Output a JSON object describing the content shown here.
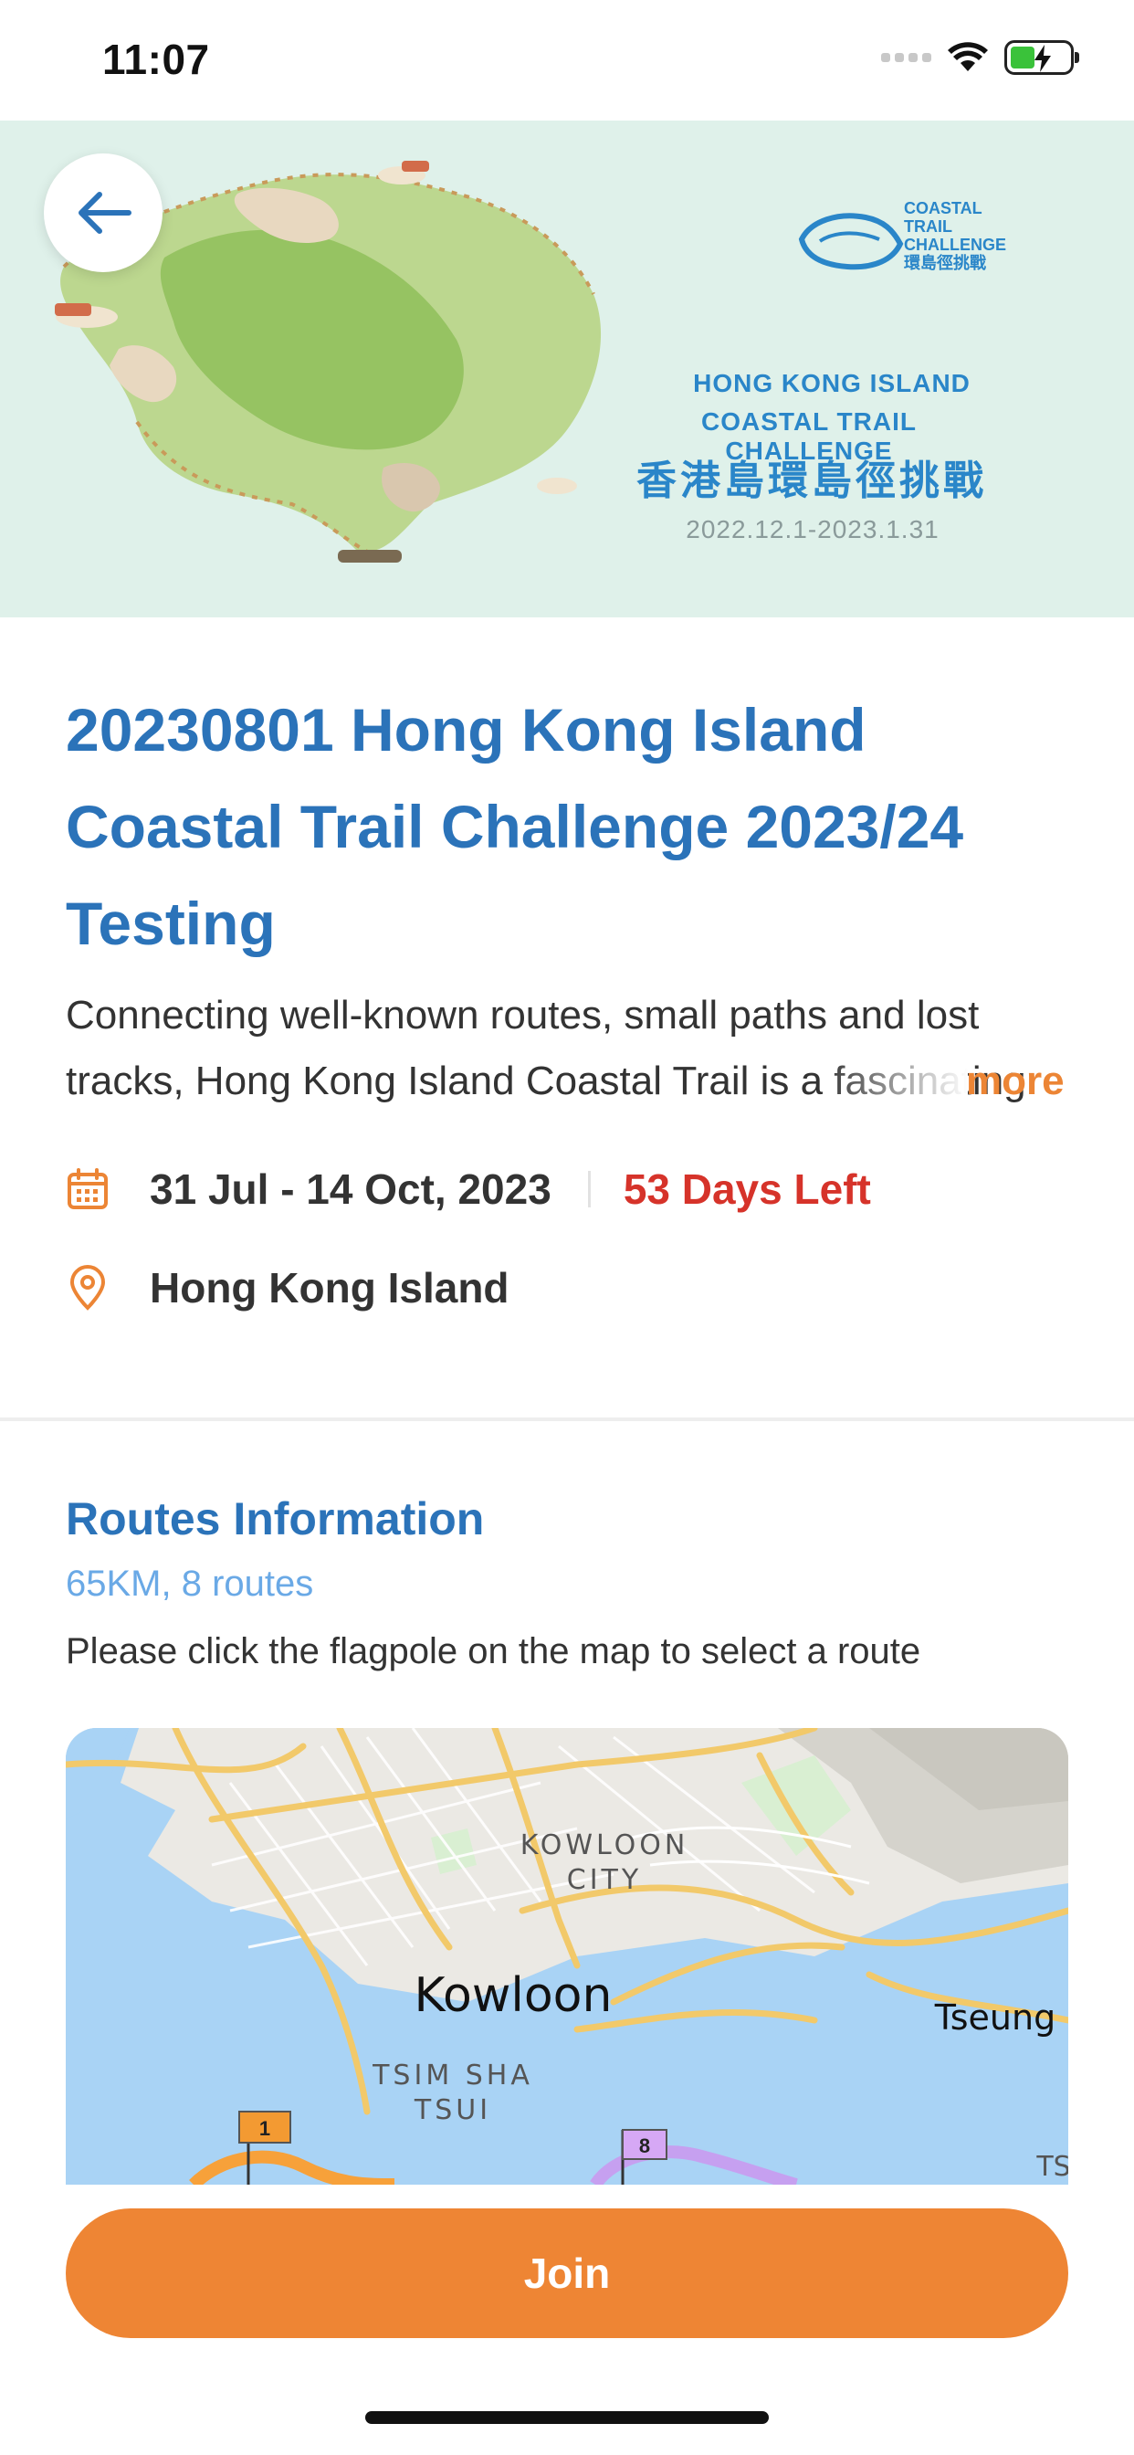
{
  "status_bar": {
    "time": "11:07",
    "icons": [
      "signal-dots-icon",
      "wifi-icon",
      "battery-charging-icon"
    ]
  },
  "banner": {
    "logo_text_line1": "COASTAL",
    "logo_text_line2": "TRAIL",
    "logo_text_line3": "CHALLENGE",
    "logo_text_line4": "環島徑挑戰",
    "title_en_line1": "HONG KONG ISLAND",
    "title_en_line2": "COASTAL TRAIL CHALLENGE",
    "title_zh": "香港島環島徑挑戰",
    "dates": "2022.12.1-2023.1.31"
  },
  "event": {
    "title": "20230801 Hong Kong Island Coastal Trail Challenge 2023/24 Testing",
    "description": "Connecting well-known routes, small paths and lost tracks, Hong Kong Island Coastal Trail is a fascinating",
    "more_label": "more",
    "date_range": "31 Jul - 14 Oct, 2023",
    "days_left": "53 Days Left",
    "location": "Hong Kong Island"
  },
  "routes": {
    "title": "Routes Information",
    "summary": "65KM, 8 routes",
    "instruction": "Please click the flagpole on the map to select a route",
    "map_labels": {
      "kowloon_city_1": "KOWLOON",
      "kowloon_city_2": "CITY",
      "kowloon": "Kowloon",
      "tsim_sha_1": "TSIM SHA",
      "tsim_sha_2": "TSUI",
      "tseung": "Tseung",
      "ts": "TS"
    },
    "flags": [
      "1",
      "8"
    ]
  },
  "actions": {
    "join_label": "Join"
  },
  "colors": {
    "primary_blue": "#2b73b9",
    "accent_orange": "#ee8534",
    "days_left_red": "#d6332a",
    "light_blue": "#6aa9e6"
  }
}
